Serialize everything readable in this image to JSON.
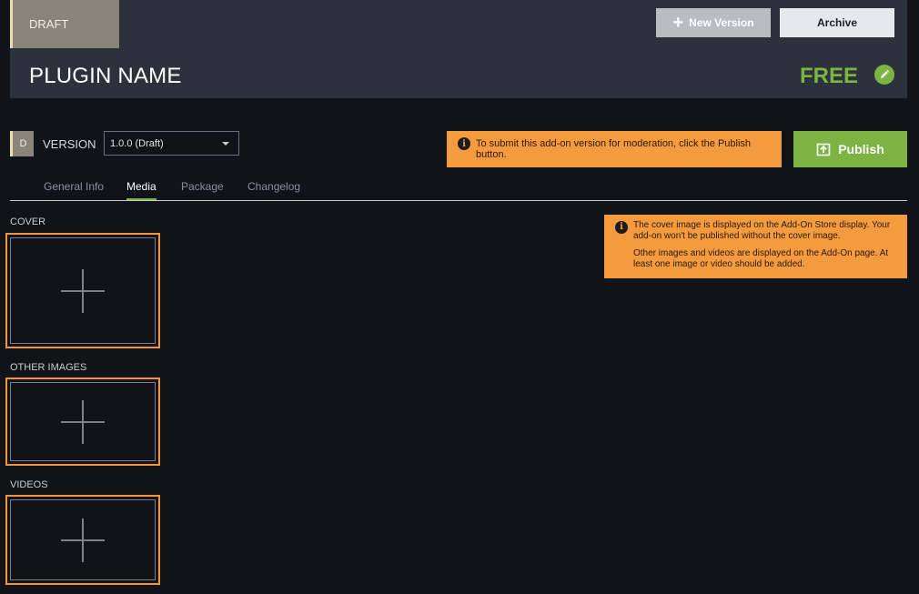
{
  "header": {
    "status_chip": "DRAFT",
    "new_version_label": "New Version",
    "archive_label": "Archive",
    "plugin_name": "PLUGIN NAME",
    "price": "FREE"
  },
  "version": {
    "badge": "D",
    "label": "VERSION",
    "selected": "1.0.0 (Draft)"
  },
  "notice_top": "To submit this add-on version for moderation, click the Publish button.",
  "publish_label": "Publish",
  "tabs": [
    {
      "label": "General Info",
      "active": false
    },
    {
      "label": "Media",
      "active": true
    },
    {
      "label": "Package",
      "active": false
    },
    {
      "label": "Changelog",
      "active": false
    }
  ],
  "media": {
    "cover_label": "COVER",
    "other_images_label": "OTHER IMAGES",
    "videos_label": "VIDEOS",
    "notice_line1": "The cover image is displayed on the Add-On Store display. Your add-on won't be published without the cover image.",
    "notice_line2": "Other images and videos are displayed on the Add-On page. At least one image or video should be added."
  },
  "icons": {
    "new_version": "plus-icon",
    "edit": "pencil-icon",
    "publish": "upload-icon",
    "info": "info-icon",
    "add_media": "plus-icon"
  },
  "colors": {
    "accent_green": "#7cb342",
    "warning_orange": "#f59b3f",
    "drop_zone_border": "#f5923a",
    "draft_chip": "#8a8479"
  }
}
